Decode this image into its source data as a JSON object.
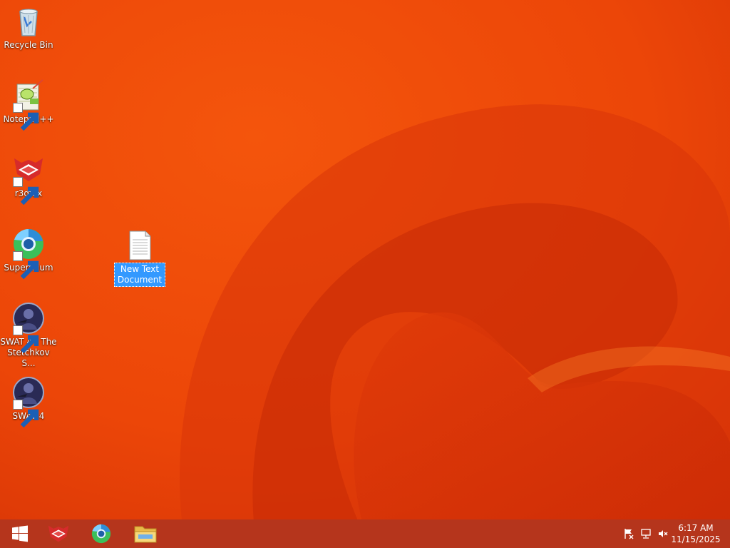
{
  "desktop": {
    "icons": [
      {
        "name": "recycle-bin",
        "label": "Recycle Bin"
      },
      {
        "name": "notepad-plus-plus",
        "label": "Notepad++"
      },
      {
        "name": "r3dfox",
        "label": "r3dfox"
      },
      {
        "name": "supermium",
        "label": "Supermium"
      },
      {
        "name": "swat4-stetchkov",
        "label": "SWAT 4 - The Stetchkov S..."
      },
      {
        "name": "swat4",
        "label": "SWAT 4"
      }
    ],
    "renaming_file": {
      "label_line1": "New Text",
      "label_line2": "Document"
    }
  },
  "taskbar": {
    "pinned": [
      {
        "name": "start-button",
        "icon": "windows-logo-icon"
      },
      {
        "name": "r3dfox-taskbar",
        "icon": "r3dfox-icon"
      },
      {
        "name": "supermium-taskbar",
        "icon": "supermium-icon"
      },
      {
        "name": "file-explorer-taskbar",
        "icon": "folder-icon"
      }
    ],
    "tray": {
      "icons": [
        "action-center-flag-icon",
        "network-icon",
        "volume-muted-icon"
      ],
      "time": "6:17 AM",
      "date": "11/15/2025"
    }
  },
  "colors": {
    "wallpaper": "#ea3a08",
    "taskbar": "#b5351c",
    "selection": "#3399ff"
  }
}
